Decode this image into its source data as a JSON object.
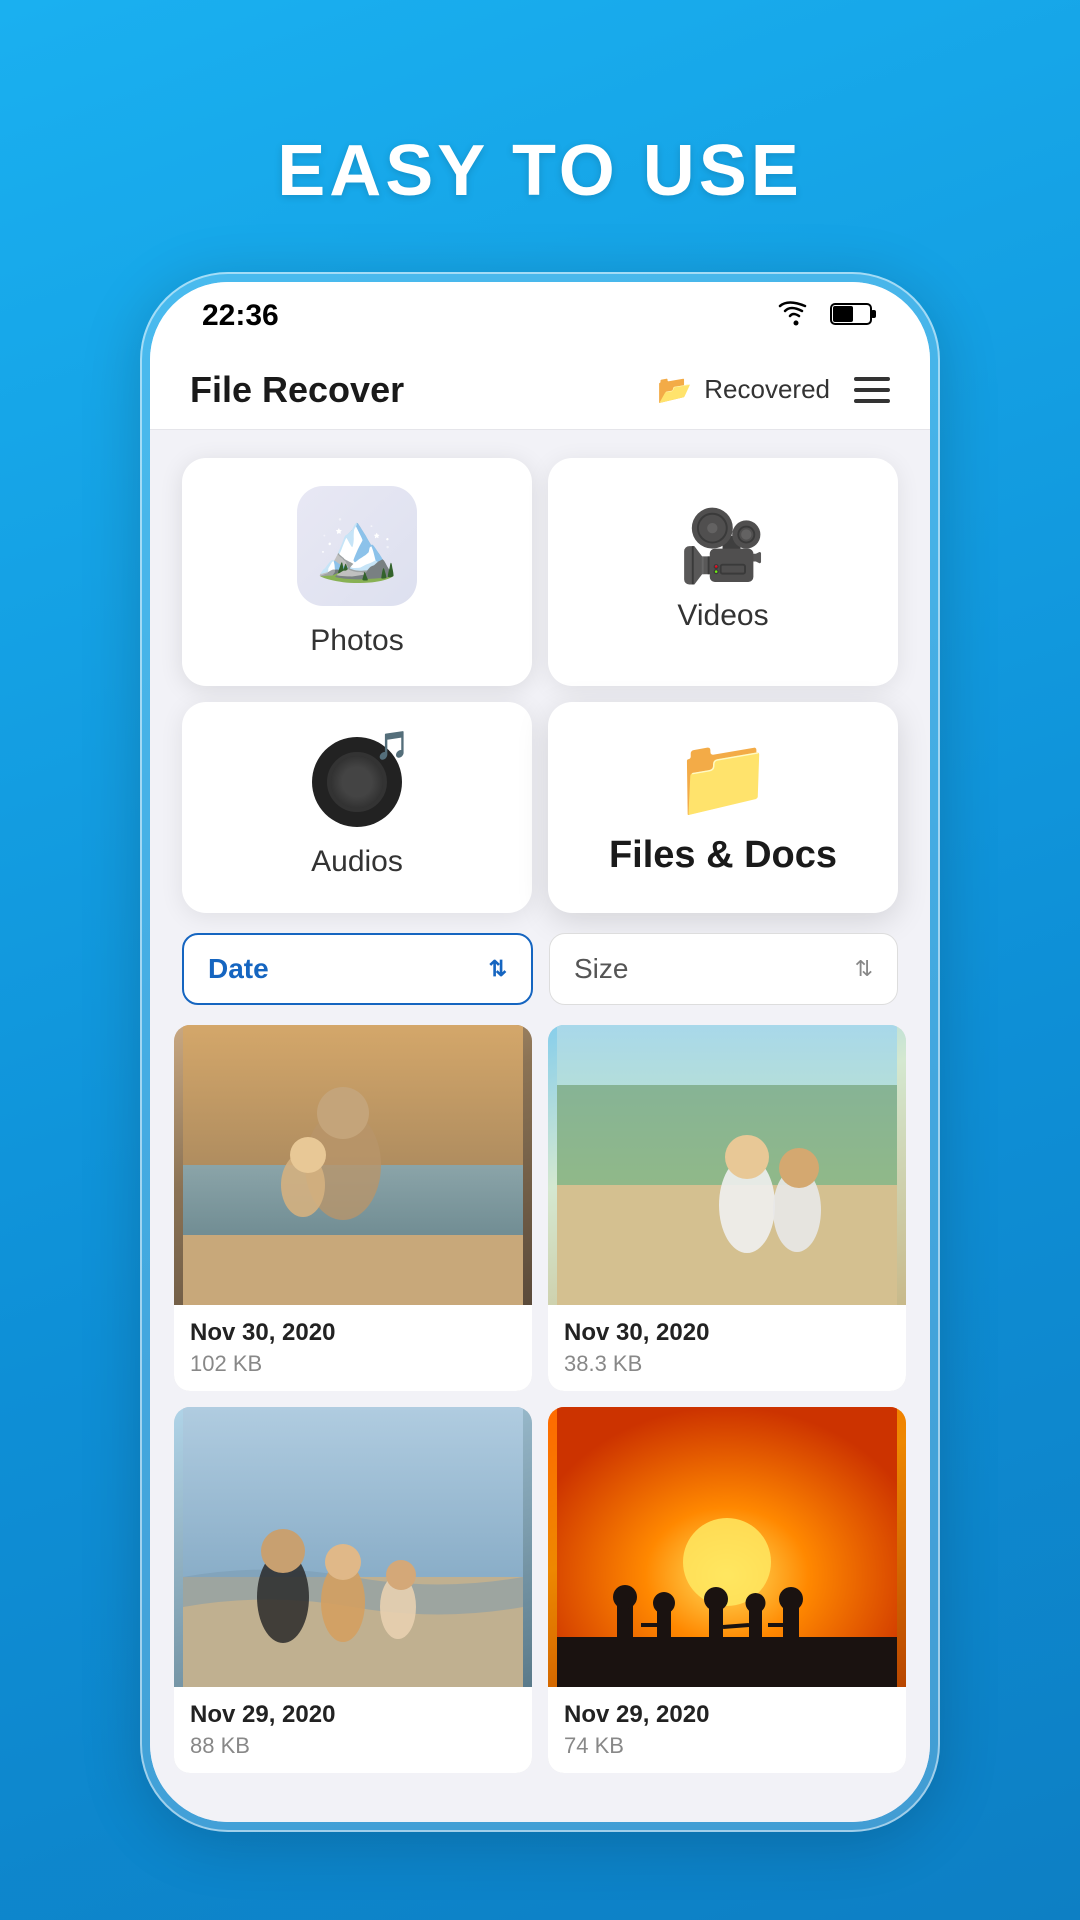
{
  "headline": "EASY TO USE",
  "status_bar": {
    "time": "22:36",
    "wifi_icon": "wifi-icon",
    "battery_icon": "battery-icon"
  },
  "header": {
    "title": "File Recover",
    "recovered_label": "Recovered",
    "hamburger_icon": "hamburger-icon"
  },
  "categories": [
    {
      "id": "photos",
      "label": "Photos",
      "icon": "🏔️",
      "type": "mountain"
    },
    {
      "id": "videos",
      "label": "Videos",
      "icon": "🎥",
      "type": "video"
    },
    {
      "id": "audios",
      "label": "Audios",
      "icon": "audio",
      "type": "audio"
    },
    {
      "id": "filesdocs",
      "label": "Files & Docs",
      "icon": "📁",
      "type": "folder"
    }
  ],
  "sort": {
    "date_label": "Date",
    "size_label": "Size"
  },
  "photos": [
    {
      "date": "Nov 30, 2020",
      "size": "102 KB",
      "style": "beach-family"
    },
    {
      "date": "Nov 30, 2020",
      "size": "38.3 KB",
      "style": "kids-beach"
    },
    {
      "date": "Nov 29, 2020",
      "size": "88 KB",
      "style": "family-beach"
    },
    {
      "date": "Nov 29, 2020",
      "size": "74 KB",
      "style": "sunset"
    }
  ]
}
